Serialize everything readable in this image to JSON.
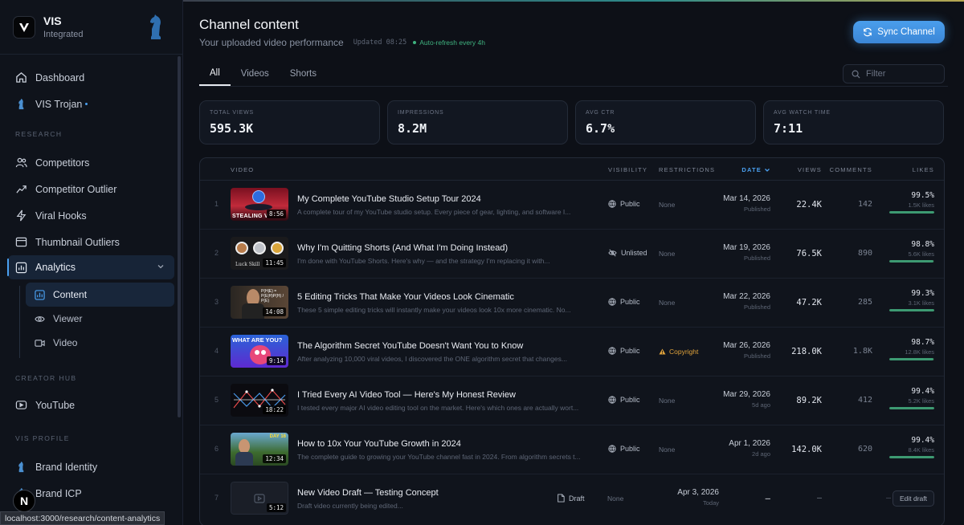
{
  "sidebar": {
    "brand_name": "VIS",
    "brand_sub": "Integrated",
    "items_top": [
      {
        "label": "Dashboard",
        "icon": "home-icon"
      },
      {
        "label": "VIS Trojan",
        "icon": "trojan-icon"
      }
    ],
    "section_research": "RESEARCH",
    "research_items": [
      {
        "label": "Competitors",
        "icon": "users-icon"
      },
      {
        "label": "Competitor Outlier",
        "icon": "trend-icon"
      },
      {
        "label": "Viral Hooks",
        "icon": "bolt-icon"
      },
      {
        "label": "Thumbnail Outliers",
        "icon": "image-icon"
      }
    ],
    "analytics_label": "Analytics",
    "analytics_sub": [
      {
        "label": "Content",
        "icon": "grid-icon"
      },
      {
        "label": "Viewer",
        "icon": "eye-icon"
      },
      {
        "label": "Video",
        "icon": "video-icon"
      }
    ],
    "section_creator": "CREATOR HUB",
    "creator_items": [
      {
        "label": "YouTube",
        "icon": "youtube-icon"
      }
    ],
    "section_profile": "VIS PROFILE",
    "profile_items": [
      {
        "label": "Brand Identity",
        "icon": "brand-icon"
      },
      {
        "label": "Brand ICP",
        "icon": "target-icon"
      }
    ],
    "n_badge": "N",
    "status_url": "localhost:3000/research/content-analytics"
  },
  "header": {
    "title": "Channel content",
    "subtitle": "Your uploaded video performance",
    "updated": "Updated 08:25",
    "auto_refresh": "Auto-refresh every 4h",
    "sync_label": "Sync Channel"
  },
  "tabs": [
    "All",
    "Videos",
    "Shorts"
  ],
  "filter_placeholder": "Filter",
  "stats": [
    {
      "label": "TOTAL VIEWS",
      "value": "595.3K"
    },
    {
      "label": "IMPRESSIONS",
      "value": "8.2M"
    },
    {
      "label": "AVG CTR",
      "value": "6.7%"
    },
    {
      "label": "AVG WATCH TIME",
      "value": "7:11"
    }
  ],
  "table": {
    "headers": {
      "video": "VIDEO",
      "visibility": "VISIBILITY",
      "restrictions": "RESTRICTIONS",
      "date": "DATE",
      "views": "VIEWS",
      "comments": "COMMENTS",
      "likes": "LIKES"
    },
    "rows": [
      {
        "num": "1",
        "title": "My Complete YouTube Studio Setup Tour 2024",
        "desc": "A complete tour of my YouTube studio setup. Every piece of gear, lighting, and software I...",
        "duration": "8:56",
        "thumb_text": "STEALING V",
        "visibility": "Public",
        "vis_icon": "globe-icon",
        "restrictions": "None",
        "date": "Mar 14, 2026",
        "date_sub": "Published",
        "views": "22.4K",
        "comments": "142",
        "likes_pct": "99.5%",
        "likes_count": "1.5K likes",
        "likes_frac": 0.995
      },
      {
        "num": "2",
        "title": "Why I'm Quitting Shorts (And What I'm Doing Instead)",
        "desc": "I'm done with YouTube Shorts. Here's why — and the strategy I'm replacing it with...",
        "duration": "11:45",
        "thumb_text": "Luck  Skill",
        "visibility": "Unlisted",
        "vis_icon": "eye-off-icon",
        "restrictions": "None",
        "date": "Mar 19, 2026",
        "date_sub": "Published",
        "views": "76.5K",
        "comments": "890",
        "likes_pct": "98.8%",
        "likes_count": "5.6K likes",
        "likes_frac": 0.988
      },
      {
        "num": "3",
        "title": "5 Editing Tricks That Make Your Videos Look Cinematic",
        "desc": "These 5 simple editing tricks will instantly make your videos look 10x more cinematic. No...",
        "duration": "14:08",
        "thumb_text": "P(H|E) = P(E|H)P(H) / P(E)",
        "visibility": "Public",
        "vis_icon": "globe-icon",
        "restrictions": "None",
        "date": "Mar 22, 2026",
        "date_sub": "Published",
        "views": "47.2K",
        "comments": "285",
        "likes_pct": "99.3%",
        "likes_count": "3.1K likes",
        "likes_frac": 0.993
      },
      {
        "num": "4",
        "title": "The Algorithm Secret YouTube Doesn't Want You to Know",
        "desc": "After analyzing 10,000 viral videos, I discovered the ONE algorithm secret that changes...",
        "duration": "9:14",
        "thumb_text": "WHAT ARE YOU?",
        "visibility": "Public",
        "vis_icon": "globe-icon",
        "restrictions": "Copyright",
        "restr_warn": true,
        "date": "Mar 26, 2026",
        "date_sub": "Published",
        "views": "218.0K",
        "comments": "1.8K",
        "likes_pct": "98.7%",
        "likes_count": "12.8K likes",
        "likes_frac": 0.987
      },
      {
        "num": "5",
        "title": "I Tried Every AI Video Tool — Here's My Honest Review",
        "desc": "I tested every major AI video editing tool on the market. Here's which ones are actually wort...",
        "duration": "18:22",
        "thumb_text": "",
        "visibility": "Public",
        "vis_icon": "globe-icon",
        "restrictions": "None",
        "date": "Mar 29, 2026",
        "date_sub": "5d ago",
        "views": "89.2K",
        "comments": "412",
        "likes_pct": "99.4%",
        "likes_count": "5.2K likes",
        "likes_frac": 0.994
      },
      {
        "num": "6",
        "title": "How to 10x Your YouTube Growth in 2024",
        "desc": "The complete guide to growing your YouTube channel fast in 2024. From algorithm secrets t...",
        "duration": "12:34",
        "thumb_text": "DAY 16",
        "visibility": "Public",
        "vis_icon": "globe-icon",
        "restrictions": "None",
        "date": "Apr 1, 2026",
        "date_sub": "2d ago",
        "views": "142.0K",
        "comments": "620",
        "likes_pct": "99.4%",
        "likes_count": "8.4K likes",
        "likes_frac": 0.994
      },
      {
        "num": "7",
        "title": "New Video Draft — Testing Concept",
        "desc": "Draft video currently being edited...",
        "duration": "5:12",
        "thumb_text": "",
        "visibility": "Draft",
        "vis_icon": "file-icon",
        "restrictions": "None",
        "date": "Apr 3, 2026",
        "date_sub": "Today",
        "views": "—",
        "comments": "—",
        "likes_dash": "—",
        "edit_label": "Edit draft"
      }
    ]
  },
  "colors": {
    "accent": "#4aa0f0",
    "positive": "#3d9a72",
    "warning": "#e0a33b",
    "bg": "#0d1017"
  }
}
